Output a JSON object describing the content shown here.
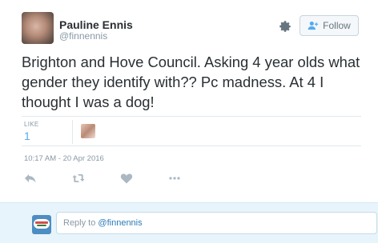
{
  "author": {
    "name": "Pauline Ennis",
    "handle": "@finnennis"
  },
  "follow_label": "Follow",
  "tweet_text": "Brighton and Hove Council. Asking 4 year olds what gender they identify with?? Pc madness. At 4 I thought I was a dog!",
  "likes": {
    "label": "LIKE",
    "count": "1"
  },
  "timestamp": "10:17 AM - 20 Apr 2016",
  "actions": [
    "reply-icon",
    "retweet-icon",
    "like-icon",
    "more-icon"
  ],
  "reply": {
    "prefix": "Reply to ",
    "mention": "@finnennis"
  },
  "colors": {
    "accent": "#55acee",
    "mention": "#2b7bb9",
    "muted": "#8899a6",
    "reply_bg": "#e8f4fb"
  }
}
